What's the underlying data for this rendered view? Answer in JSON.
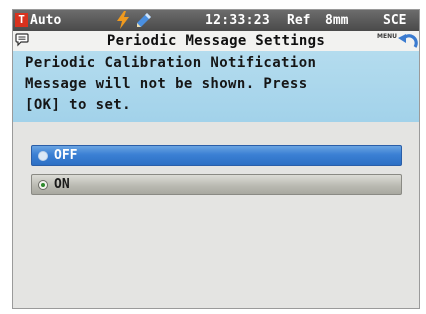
{
  "status_bar": {
    "mode": "Auto",
    "mode_badge": "T",
    "mode_badge_color": "#d8321e",
    "icons": [
      "lightning-bolt-icon",
      "pencil-icon"
    ],
    "time": "12:33:23",
    "ref": "Ref",
    "aperture": "8mm",
    "specular_mode": "SCE"
  },
  "title_bar": {
    "icon": "speech-bubble-icon",
    "title": "Periodic Message Settings",
    "menu_label": "MENU",
    "back_icon": "back-arrow-icon"
  },
  "message": {
    "lines": [
      "Periodic Calibration Notification",
      "Message will not be shown. Press",
      "[OK] to set."
    ],
    "background_color": "#a8d6ec"
  },
  "options": [
    {
      "label": "OFF",
      "selected": true
    },
    {
      "label": "ON",
      "selected": false,
      "checked": true
    }
  ],
  "colors": {
    "selected_option": "#3b80d4",
    "screen_background": "#e4e4e2",
    "radio_dot": "#2e8a2e"
  }
}
